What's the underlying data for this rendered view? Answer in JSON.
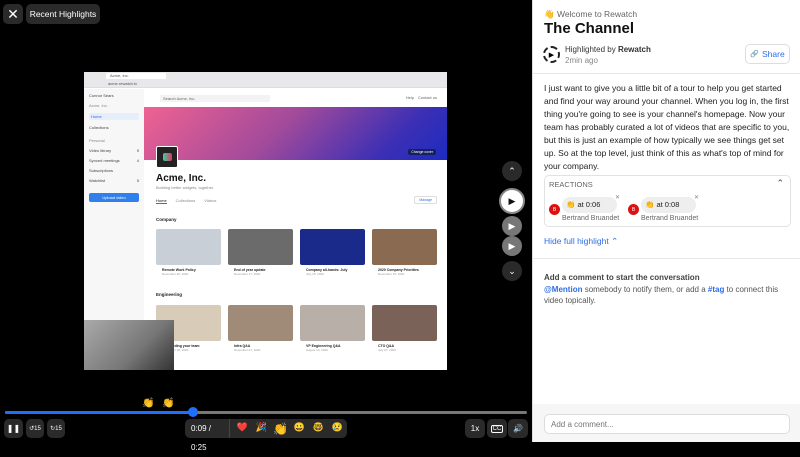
{
  "player": {
    "close_icon": "✕",
    "recent_label": "Recent Highlights",
    "time": "0:09 / 0:25",
    "progress_fraction": 0.36,
    "speed": "1x",
    "cc": "CC",
    "volume_icon": "🔊",
    "pause_icon": "❚❚",
    "rewind_label": "15",
    "forward_label": "15",
    "reactions_bar": [
      "❤️",
      "🎉",
      "👏",
      "😀",
      "🤓",
      "😢"
    ],
    "timeline_markers": [
      "👏",
      "👏"
    ]
  },
  "nav": {
    "up": "⌃",
    "down": "⌄",
    "play": "▶"
  },
  "screen": {
    "tab": "Acme, Inc.",
    "url": "acme.rewatch.tv",
    "user": "Connor Sears",
    "org": "Acme, Inc.",
    "sidebar": [
      "Home",
      "Collections"
    ],
    "personal_label": "Personal",
    "personal": [
      {
        "label": "Video library",
        "count": "9"
      },
      {
        "label": "Synced meetings",
        "count": "4"
      },
      {
        "label": "Subscriptions",
        "count": ""
      },
      {
        "label": "Watchlist",
        "count": "5"
      }
    ],
    "upload": "Upload video",
    "search": "Search Acme, Inc.",
    "help": "Help",
    "contact": "Contact us",
    "change_cover": "Change cover",
    "company_name": "Acme, Inc.",
    "tagline": "Building better widgets, together.",
    "tabs": [
      "Home",
      "Collections",
      "Videos"
    ],
    "manage": "Manage",
    "sections": [
      {
        "title": "Company",
        "videos": [
          {
            "t": "Remote Work Policy",
            "d": "December 20, 2020",
            "c": "#c9cfd6"
          },
          {
            "t": "End of year update",
            "d": "December 17, 2020",
            "c": "#6b6b6b"
          },
          {
            "t": "Company all-hands: July",
            "d": "July 15, 2020",
            "c": "#1a2a8a"
          },
          {
            "t": "2020 Company Priorities",
            "d": "December 15, 2020",
            "c": "#8a6a50"
          }
        ]
      },
      {
        "title": "Engineering",
        "videos": [
          {
            "t": "Onboarding your team",
            "d": "November 18, 2020",
            "c": "#d8cbb8"
          },
          {
            "t": "Infra Q&A",
            "d": "November 07, 2020",
            "c": "#a08a78"
          },
          {
            "t": "VP Engineering Q&A",
            "d": "August 14, 2020",
            "c": "#b8b0a8"
          },
          {
            "t": "CTO Q&A",
            "d": "July 07, 2020",
            "c": "#7a6258"
          }
        ]
      }
    ]
  },
  "panel": {
    "welcome": "👋 Welcome to Rewatch",
    "title": "The Channel",
    "highlighted_by": "Highlighted by",
    "author": "Rewatch",
    "ago": "2min ago",
    "share": "Share",
    "share_icon": "🔗",
    "description": "I just want to give you a little bit of a tour to help you get started and find your way around your channel. When you log in, the first thing you're going to see is your channel's homepage. Now your team has probably curated a lot of videos that are specific to you, but this is just an example of how typically we see things get set up. So at the top level, just think of this as what's top of mind for your company.",
    "reactions_label": "REACTIONS",
    "reactions": [
      {
        "emoji": "👏",
        "time": "at 0:06",
        "user": "Bertrand Bruandet",
        "initial": "B"
      },
      {
        "emoji": "👏",
        "time": "at 0:08",
        "user": "Bertrand Bruandet",
        "initial": "B"
      }
    ],
    "hide": "Hide full highlight",
    "comment_heading": "Add a comment to start the conversation",
    "mention": "@Mention",
    "mid": " somebody to notify them, or add a ",
    "tag": "#tag",
    "end": " to connect this video topically.",
    "comment_placeholder": "Add a comment..."
  }
}
